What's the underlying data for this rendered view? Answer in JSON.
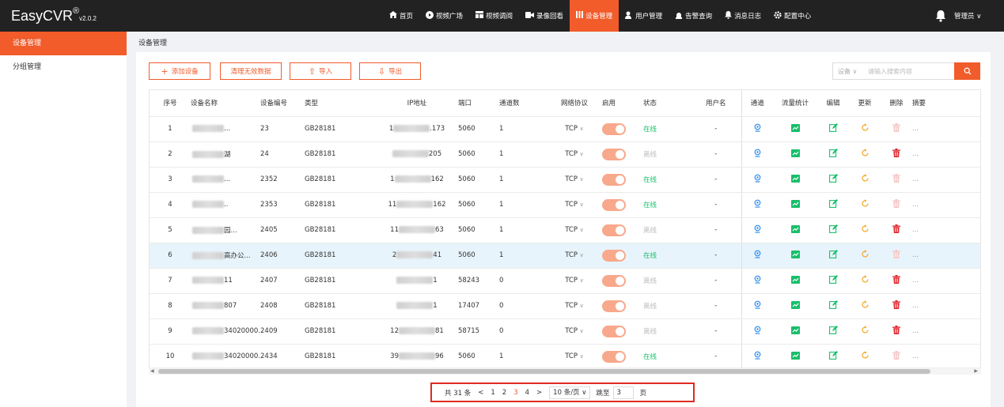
{
  "app": {
    "logo_main": "EasyCVR",
    "logo_reg": "®",
    "logo_ver": "v2.0.2"
  },
  "nav": [
    {
      "icon": "home-icon",
      "label": "首页"
    },
    {
      "icon": "play-icon",
      "label": "视频广场"
    },
    {
      "icon": "grid-icon",
      "label": "视频调阅"
    },
    {
      "icon": "camera-icon",
      "label": "录像回看"
    },
    {
      "icon": "device-icon",
      "label": "设备管理",
      "active": true
    },
    {
      "icon": "person-icon",
      "label": "用户管理"
    },
    {
      "icon": "alarm-icon",
      "label": "告警查询"
    },
    {
      "icon": "bell-icon",
      "label": "消息日志"
    },
    {
      "icon": "gear-icon",
      "label": "配置中心"
    }
  ],
  "user": {
    "name": "管理员",
    "caret": "∨"
  },
  "sidebar": {
    "items": [
      {
        "label": "设备管理",
        "active": true
      },
      {
        "label": "分组管理"
      }
    ]
  },
  "breadcrumb": "设备管理",
  "toolbar": {
    "add_label": "添加设备",
    "add_icon": "+",
    "clear_label": "清理无效数据",
    "import_label": "导入",
    "import_icon": "⇧",
    "export_label": "导出",
    "export_icon": "⇩"
  },
  "search": {
    "type_label": "设备 ∨",
    "placeholder": "请输入搜索内容",
    "value": ""
  },
  "table": {
    "headers": [
      "序号",
      "设备名称",
      "设备编号",
      "类型",
      "IP地址",
      "端口",
      "通道数",
      "网络协议",
      "启用",
      "状态",
      "用户名",
      "通道",
      "流量统计",
      "编辑",
      "更新",
      "删除",
      "摘要"
    ],
    "rows": [
      {
        "idx": "1",
        "name": "...",
        "code": "23",
        "type": "GB28181",
        "ip_pre": "1",
        "ip_suf": ".173",
        "port": "5060",
        "ch": "1",
        "proto": "TCP",
        "status": "在线",
        "online": true,
        "user": "-",
        "del": false,
        "sum": "..."
      },
      {
        "idx": "2",
        "name": "湖",
        "code": "24",
        "type": "GB28181",
        "ip_pre": "",
        "ip_suf": "205",
        "port": "5060",
        "ch": "1",
        "proto": "TCP",
        "status": "离线",
        "online": false,
        "user": "-",
        "del": true,
        "sum": "..."
      },
      {
        "idx": "3",
        "name": "...",
        "code": "2352",
        "type": "GB28181",
        "ip_pre": "1",
        "ip_suf": "162",
        "port": "5060",
        "ch": "1",
        "proto": "TCP",
        "status": "在线",
        "online": true,
        "user": "-",
        "del": false,
        "sum": "..."
      },
      {
        "idx": "4",
        "name": "..",
        "code": "2353",
        "type": "GB28181",
        "ip_pre": "11",
        "ip_suf": "162",
        "port": "5060",
        "ch": "1",
        "proto": "TCP",
        "status": "在线",
        "online": true,
        "user": "-",
        "del": false,
        "sum": "..."
      },
      {
        "idx": "5",
        "name": "园...",
        "code": "2405",
        "type": "GB28181",
        "ip_pre": "11",
        "ip_suf": "63",
        "port": "5060",
        "ch": "1",
        "proto": "TCP",
        "status": "离线",
        "online": false,
        "user": "-",
        "del": true,
        "sum": "..."
      },
      {
        "idx": "6",
        "name": "高",
        "name2": "办公...",
        "code": "2406",
        "type": "GB28181",
        "ip_pre": "2",
        "ip_suf": "41",
        "port": "5060",
        "ch": "1",
        "proto": "TCP",
        "status": "在线",
        "online": true,
        "user": "-",
        "del": false,
        "sum": "..."
      },
      {
        "idx": "7",
        "name": "11",
        "code": "2407",
        "type": "GB28181",
        "ip_pre": "",
        "ip_suf": "1",
        "port": "58243",
        "ch": "0",
        "proto": "TCP",
        "status": "离线",
        "online": false,
        "user": "-",
        "del": true,
        "sum": "..."
      },
      {
        "idx": "8",
        "name": "807",
        "code": "2408",
        "type": "GB28181",
        "ip_pre": "",
        "ip_suf": "1",
        "port": "17407",
        "ch": "0",
        "proto": "TCP",
        "status": "离线",
        "online": false,
        "user": "-",
        "del": true,
        "sum": "..."
      },
      {
        "idx": "9",
        "name": "34020000...",
        "code": "2409",
        "type": "GB28181",
        "ip_pre": "12",
        "ip_suf": "81",
        "port": "58715",
        "ch": "0",
        "proto": "TCP",
        "status": "离线",
        "online": false,
        "user": "-",
        "del": true,
        "sum": "..."
      },
      {
        "idx": "10",
        "name": "34020000...",
        "code": "2434",
        "type": "GB28181",
        "ip_pre": "39",
        "ip_suf": "96",
        "port": "5060",
        "ch": "1",
        "proto": "TCP",
        "status": "在线",
        "online": true,
        "user": "-",
        "del": false,
        "sum": "..."
      }
    ]
  },
  "pager": {
    "total": "共 31 条",
    "prev": "<",
    "pages": [
      "1",
      "2",
      "3",
      "4"
    ],
    "current": "3",
    "next": ">",
    "size": "10 条/页 ∨",
    "jump": "跳至",
    "jump_value": "3",
    "page_suffix": "页"
  },
  "colors": {
    "accent": "#f25b2a",
    "online": "#19be6b",
    "delete": "#e0242b",
    "locate": "#2d8cf0",
    "edit": "#19be6b",
    "refresh": "#f5a623"
  }
}
